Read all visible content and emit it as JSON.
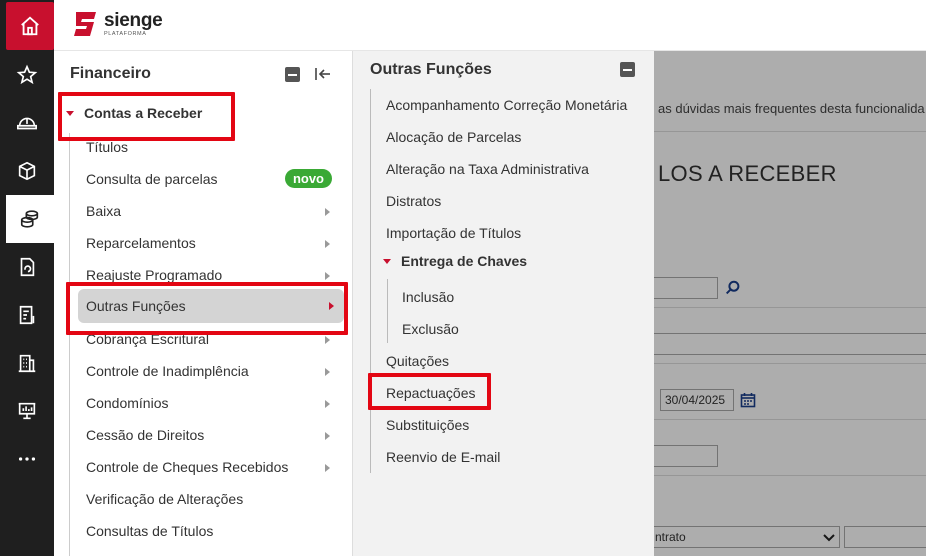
{
  "brand": {
    "name": "sienge",
    "sub": "PLATAFORMA",
    "color": "#c8102e"
  },
  "rail": {
    "icons": [
      "home-icon",
      "star-icon",
      "helmet-icon",
      "box-icon",
      "coins-icon",
      "document-icon",
      "receipt-icon",
      "building-icon",
      "presentation-icon",
      "more-icon"
    ],
    "active": "coins-icon"
  },
  "financeiro": {
    "title": "Financeiro",
    "group_label": "Contas a Receber",
    "items": [
      {
        "label": "Títulos"
      },
      {
        "label": "Consulta de parcelas",
        "badge": "novo"
      },
      {
        "label": "Baixa"
      },
      {
        "label": "Reparcelamentos"
      },
      {
        "label": "Reajuste Programado"
      },
      {
        "label": "Outras Funções"
      },
      {
        "label": "Cobrança Escritural"
      },
      {
        "label": "Controle de Inadimplência"
      },
      {
        "label": "Condomínios"
      },
      {
        "label": "Cessão de Direitos"
      },
      {
        "label": "Controle de Cheques Recebidos"
      },
      {
        "label": "Verificação de Alterações"
      },
      {
        "label": "Consultas de Títulos"
      }
    ]
  },
  "outras_funcoes": {
    "title": "Outras Funções",
    "items": [
      {
        "label": "Acompanhamento Correção Monetária"
      },
      {
        "label": "Alocação de Parcelas"
      },
      {
        "label": "Alteração na Taxa Administrativa"
      },
      {
        "label": "Distratos"
      },
      {
        "label": "Importação de Títulos"
      }
    ],
    "group_label": "Entrega de Chaves",
    "sub_items": [
      {
        "label": "Inclusão"
      },
      {
        "label": "Exclusão"
      }
    ],
    "items_after": [
      {
        "label": "Quitações"
      },
      {
        "label": "Repactuações"
      },
      {
        "label": "Substituições"
      },
      {
        "label": "Reenvio de E-mail"
      }
    ]
  },
  "background": {
    "help_text": "as dúvidas mais frequentes desta funcionalida",
    "page_title": "LOS A RECEBER",
    "date_value": "30/04/2025",
    "select_text": "ntrato"
  }
}
